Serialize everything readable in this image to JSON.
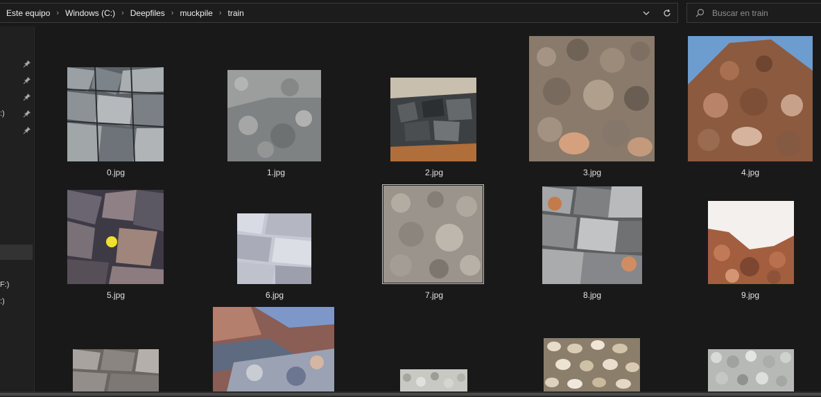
{
  "breadcrumb": [
    "Este equipo",
    "Windows (C:)",
    "Deepfiles",
    "muckpile",
    "train"
  ],
  "search": {
    "placeholder": "Buscar en train"
  },
  "nav": {
    "fragments": [
      ":)",
      "F:)",
      ":)"
    ]
  },
  "files": [
    {
      "name": "0.jpg",
      "icon": "gray-angular-rock-thumbnail"
    },
    {
      "name": "1.jpg",
      "icon": "gray-gravel-thumbnail"
    },
    {
      "name": "2.jpg",
      "icon": "dark-rock-pile-thumbnail"
    },
    {
      "name": "3.jpg",
      "icon": "brown-muckpile-thumbnail"
    },
    {
      "name": "4.jpg",
      "icon": "brown-rock-mound-thumbnail"
    },
    {
      "name": "5.jpg",
      "icon": "rocks-with-yellow-ball-thumbnail"
    },
    {
      "name": "6.jpg",
      "icon": "white-rock-thumbnail"
    },
    {
      "name": "7.jpg",
      "icon": "tan-rubble-thumbnail"
    },
    {
      "name": "8.jpg",
      "icon": "gray-rocks-with-balls-thumbnail"
    },
    {
      "name": "9.jpg",
      "icon": "reddish-rock-pile-thumbnail"
    },
    {
      "name": "",
      "icon": "gray-rock-thumbnail"
    },
    {
      "name": "",
      "icon": "quarry-wall-thumbnail"
    },
    {
      "name": "",
      "icon": "light-gravel-thumbnail"
    },
    {
      "name": "",
      "icon": "pebbles-thumbnail"
    },
    {
      "name": "",
      "icon": "white-stones-thumbnail"
    }
  ],
  "colors": {
    "background": "#191919",
    "nav": "#202020",
    "border": "#3b3b3b",
    "text": "#e6e6e6",
    "muted": "#8f8f8f"
  }
}
